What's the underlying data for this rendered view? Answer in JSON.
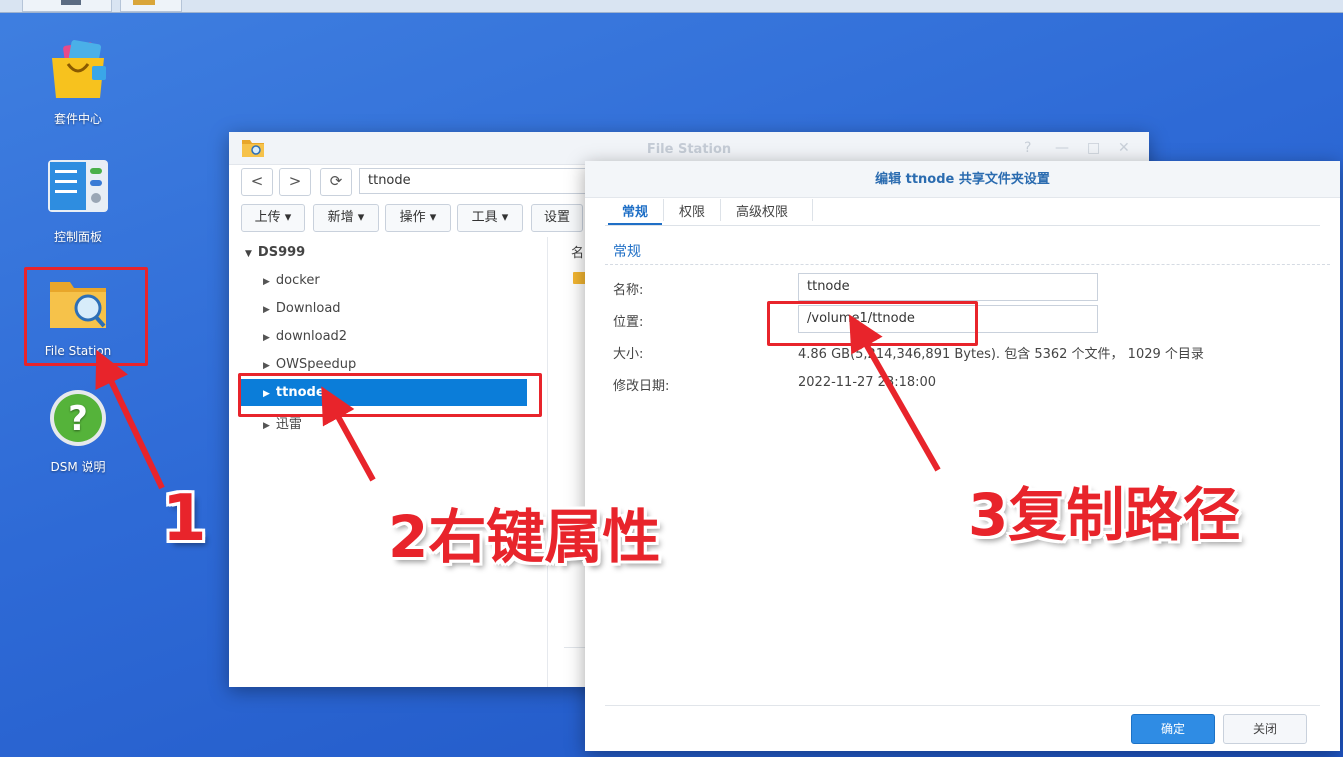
{
  "desktop": {
    "icons": [
      {
        "label": "套件中心",
        "icon": "package-center-icon"
      },
      {
        "label": "控制面板",
        "icon": "control-panel-icon"
      },
      {
        "label": "File Station",
        "icon": "file-station-icon"
      },
      {
        "label": "DSM 说明",
        "icon": "help-icon"
      }
    ]
  },
  "file_station": {
    "title": "File Station",
    "window_controls": [
      "?",
      "—",
      "□",
      "✕"
    ],
    "nav": {
      "back": "<",
      "forward": ">",
      "refresh": "⟳"
    },
    "path": "ttnode",
    "toolbar": [
      "上传 ▾",
      "新增 ▾",
      "操作 ▾",
      "工具 ▾",
      "设置"
    ],
    "tree": {
      "root": "DS999",
      "items": [
        "docker",
        "Download",
        "download2",
        "OWSpeedup",
        "ttnode",
        "迅雷"
      ],
      "selected": "ttnode"
    },
    "list_header_partial": "名"
  },
  "dialog": {
    "title": "编辑 ttnode 共享文件夹设置",
    "tabs": [
      "常规",
      "权限",
      "高级权限"
    ],
    "active_tab": "常规",
    "section": "常规",
    "fields": {
      "name_label": "名称:",
      "name_value": "ttnode",
      "location_label": "位置:",
      "location_value": "/volume1/ttnode",
      "size_label": "大小:",
      "size_value": "4.86 GB(5,214,346,891 Bytes). 包含 5362 个文件， 1029 个目录",
      "modified_label": "修改日期:",
      "modified_value": "2022-11-27 23:18:00"
    },
    "buttons": {
      "ok": "确定",
      "close": "关闭"
    }
  },
  "annotations": {
    "step1": "1",
    "step2": "2右键属性",
    "step3": "3复制路径",
    "color": "#e8242b"
  }
}
